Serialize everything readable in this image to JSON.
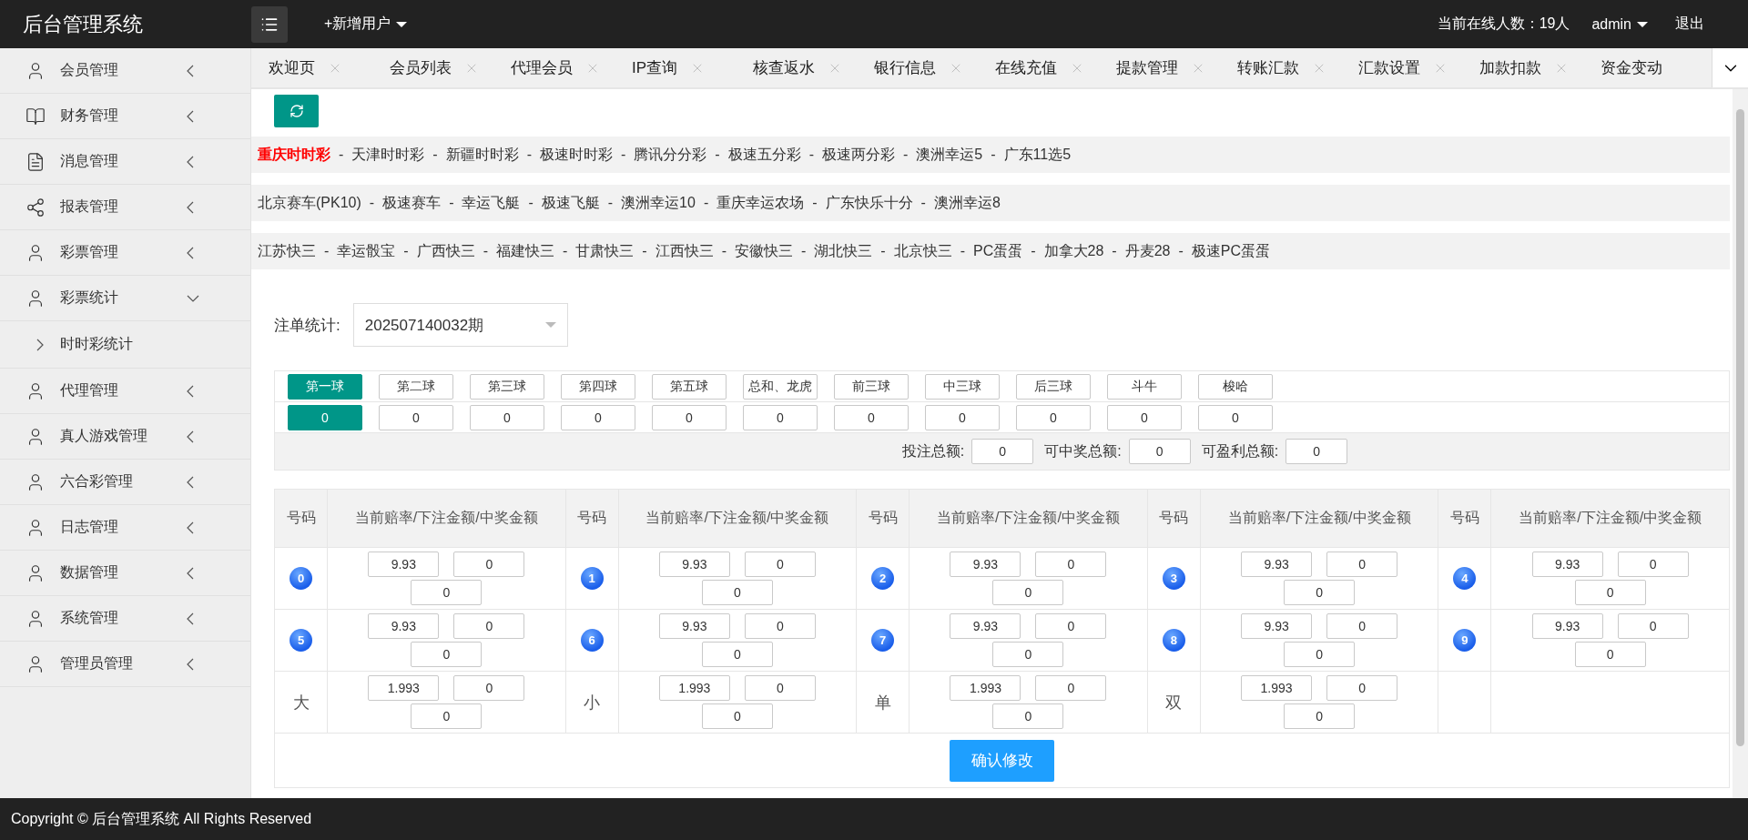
{
  "header": {
    "title": "后台管理系统",
    "add_user": "+新增用户",
    "online": "当前在线人数：19人",
    "user": "admin",
    "logout": "退出"
  },
  "sidebar": {
    "items": [
      {
        "label": "会员管理",
        "expanded": false
      },
      {
        "label": "财务管理",
        "expanded": false
      },
      {
        "label": "消息管理",
        "expanded": false
      },
      {
        "label": "报表管理",
        "expanded": false
      },
      {
        "label": "彩票管理",
        "expanded": false
      },
      {
        "label": "彩票统计",
        "expanded": true,
        "children": [
          {
            "label": "时时彩统计"
          }
        ]
      },
      {
        "label": "代理管理",
        "expanded": false
      },
      {
        "label": "真人游戏管理",
        "expanded": false
      },
      {
        "label": "六合彩管理",
        "expanded": false
      },
      {
        "label": "日志管理",
        "expanded": false
      },
      {
        "label": "数据管理",
        "expanded": false
      },
      {
        "label": "系统管理",
        "expanded": false
      },
      {
        "label": "管理员管理",
        "expanded": false
      }
    ]
  },
  "tabs": [
    "欢迎页",
    "会员列表",
    "代理会员",
    "IP查询",
    "核查返水",
    "银行信息",
    "在线充值",
    "提款管理",
    "转账汇款",
    "汇款设置",
    "加款扣款",
    "资金变动"
  ],
  "lottery_nav": {
    "separator": "-",
    "bars": [
      {
        "links": [
          {
            "label": "重庆时时彩",
            "selected": true
          },
          {
            "label": "天津时时彩",
            "selected": false
          },
          {
            "label": "新疆时时彩",
            "selected": false
          },
          {
            "label": "极速时时彩",
            "selected": false
          },
          {
            "label": "腾讯分分彩",
            "selected": false
          },
          {
            "label": "极速五分彩",
            "selected": false
          },
          {
            "label": "极速两分彩",
            "selected": false
          },
          {
            "label": "澳洲幸运5",
            "selected": false
          },
          {
            "label": "广东11选5",
            "selected": false
          }
        ]
      },
      {
        "links": [
          {
            "label": "北京赛车(PK10)",
            "selected": false
          },
          {
            "label": "极速赛车",
            "selected": false
          },
          {
            "label": "幸运飞艇",
            "selected": false
          },
          {
            "label": "极速飞艇",
            "selected": false
          },
          {
            "label": "澳洲幸运10",
            "selected": false
          },
          {
            "label": "重庆幸运农场",
            "selected": false
          },
          {
            "label": "广东快乐十分",
            "selected": false
          },
          {
            "label": "澳洲幸运8",
            "selected": false
          }
        ]
      },
      {
        "links": [
          {
            "label": "江苏快三",
            "selected": false
          },
          {
            "label": "幸运骰宝",
            "selected": false
          },
          {
            "label": "广西快三",
            "selected": false
          },
          {
            "label": "福建快三",
            "selected": false
          },
          {
            "label": "甘肃快三",
            "selected": false
          },
          {
            "label": "江西快三",
            "selected": false
          },
          {
            "label": "安徽快三",
            "selected": false
          },
          {
            "label": "湖北快三",
            "selected": false
          },
          {
            "label": "北京快三",
            "selected": false
          },
          {
            "label": "PC蛋蛋",
            "selected": false
          },
          {
            "label": "加拿大28",
            "selected": false
          },
          {
            "label": "丹麦28",
            "selected": false
          },
          {
            "label": "极速PC蛋蛋",
            "selected": false
          }
        ]
      }
    ]
  },
  "period": {
    "label": "注单统计:",
    "value": "202507140032期"
  },
  "ball_tabs": [
    {
      "label": "第一球",
      "value": "0",
      "selected": true
    },
    {
      "label": "第二球",
      "value": "0",
      "selected": false
    },
    {
      "label": "第三球",
      "value": "0",
      "selected": false
    },
    {
      "label": "第四球",
      "value": "0",
      "selected": false
    },
    {
      "label": "第五球",
      "value": "0",
      "selected": false
    },
    {
      "label": "总和、龙虎",
      "value": "0",
      "selected": false
    },
    {
      "label": "前三球",
      "value": "0",
      "selected": false
    },
    {
      "label": "中三球",
      "value": "0",
      "selected": false
    },
    {
      "label": "后三球",
      "value": "0",
      "selected": false
    },
    {
      "label": "斗牛",
      "value": "0",
      "selected": false
    },
    {
      "label": "梭哈",
      "value": "0",
      "selected": false
    }
  ],
  "totals": [
    {
      "label": "投注总额:",
      "value": "0"
    },
    {
      "label": "可中奖总额:",
      "value": "0"
    },
    {
      "label": "可盈利总额:",
      "value": "0"
    }
  ],
  "odds_table": {
    "columns": [
      "号码",
      "当前赔率/下注金额/中奖金额",
      "号码",
      "当前赔率/下注金额/中奖金额",
      "号码",
      "当前赔率/下注金额/中奖金额",
      "号码",
      "当前赔率/下注金额/中奖金额",
      "号码",
      "当前赔率/下注金额/中奖金额"
    ],
    "rows": [
      [
        {
          "kind": "ball",
          "label": "0"
        },
        {
          "kind": "inputs",
          "odds": "9.93",
          "bet": "0",
          "win": "0"
        },
        {
          "kind": "ball",
          "label": "1"
        },
        {
          "kind": "inputs",
          "odds": "9.93",
          "bet": "0",
          "win": "0"
        },
        {
          "kind": "ball",
          "label": "2"
        },
        {
          "kind": "inputs",
          "odds": "9.93",
          "bet": "0",
          "win": "0"
        },
        {
          "kind": "ball",
          "label": "3"
        },
        {
          "kind": "inputs",
          "odds": "9.93",
          "bet": "0",
          "win": "0"
        },
        {
          "kind": "ball",
          "label": "4"
        },
        {
          "kind": "inputs",
          "odds": "9.93",
          "bet": "0",
          "win": "0"
        }
      ],
      [
        {
          "kind": "ball",
          "label": "5"
        },
        {
          "kind": "inputs",
          "odds": "9.93",
          "bet": "0",
          "win": "0"
        },
        {
          "kind": "ball",
          "label": "6"
        },
        {
          "kind": "inputs",
          "odds": "9.93",
          "bet": "0",
          "win": "0"
        },
        {
          "kind": "ball",
          "label": "7"
        },
        {
          "kind": "inputs",
          "odds": "9.93",
          "bet": "0",
          "win": "0"
        },
        {
          "kind": "ball",
          "label": "8"
        },
        {
          "kind": "inputs",
          "odds": "9.93",
          "bet": "0",
          "win": "0"
        },
        {
          "kind": "ball",
          "label": "9"
        },
        {
          "kind": "inputs",
          "odds": "9.93",
          "bet": "0",
          "win": "0"
        }
      ],
      [
        {
          "kind": "text",
          "label": "大"
        },
        {
          "kind": "inputs",
          "odds": "1.993",
          "bet": "0",
          "win": "0"
        },
        {
          "kind": "text",
          "label": "小"
        },
        {
          "kind": "inputs",
          "odds": "1.993",
          "bet": "0",
          "win": "0"
        },
        {
          "kind": "text",
          "label": "单"
        },
        {
          "kind": "inputs",
          "odds": "1.993",
          "bet": "0",
          "win": "0"
        },
        {
          "kind": "text",
          "label": "双"
        },
        {
          "kind": "inputs",
          "odds": "1.993",
          "bet": "0",
          "win": "0"
        }
      ]
    ]
  },
  "confirm_button": "确认修改",
  "footer": "Copyright © 后台管理系统 All Rights Reserved"
}
